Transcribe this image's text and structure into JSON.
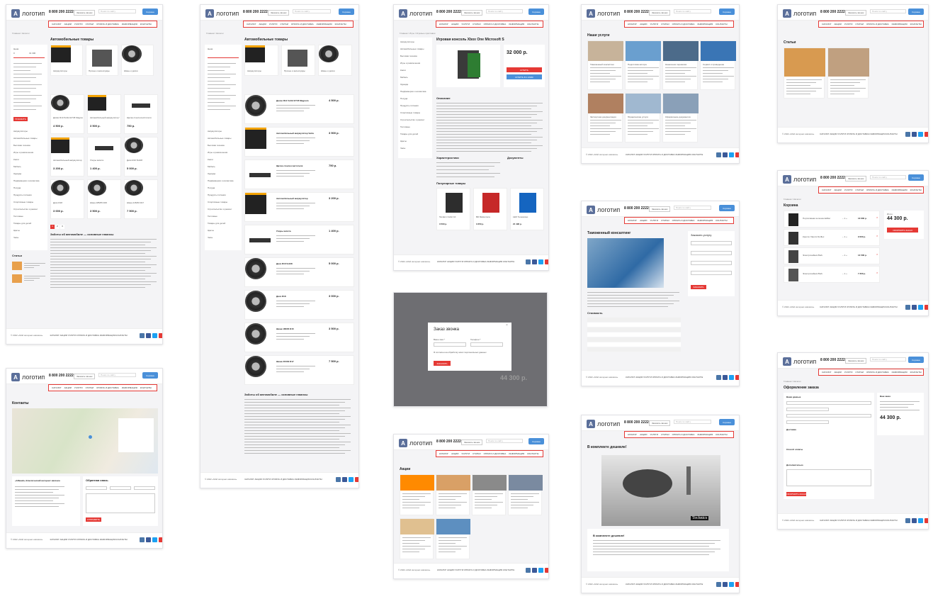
{
  "header": {
    "logo_text": "логотип",
    "phone": "8 800 200 2222",
    "callback": "Заказать звонок",
    "search_placeholder": "Поиск по сайту",
    "cart": "Корзина"
  },
  "nav": [
    "КАТАЛОГ",
    "АКЦИИ",
    "УСЛУГИ",
    "СТАТЬИ",
    "ОПЛАТА И ДОСТАВКА",
    "ИНФОРМАЦИЯ",
    "КОНТАКТЫ"
  ],
  "footer": {
    "copyright": "© 2022 «Мой интернет-магазин»",
    "links": "КАТАЛОГ  АКЦИИ  УСЛУГИ  ОПЛАТА И ДОСТАВКА  ИНФОРМАЦИЯ  КОНТАКТЫ"
  },
  "colors": {
    "accent": "#e53935",
    "brand": "#5b6f9a",
    "blue": "#4a90d9"
  },
  "pages": {
    "catalog": {
      "crumb": "Главная / Каталог",
      "title": "Автомобильные товары",
      "categories": [
        "Аккумуляторы",
        "Прочее и аксессуары",
        "Шины и диски"
      ],
      "filter_price": "Цена",
      "filter_from": "0",
      "filter_to": "31 300",
      "show_button": "ПОКАЗАТЬ",
      "sidebar": [
        "Аккумуляторы",
        "Автомобильные товары",
        "Бытовая техника",
        "Игры и развлечения",
        "Книги",
        "Мебель",
        "Одежда",
        "Парфюмерия и косметика",
        "Посуда",
        "Продукты питания",
        "Спортивные товары",
        "Строительство и ремонт",
        "Тепловые",
        "Товары для детей",
        "Цветы",
        "Часы"
      ],
      "products": [
        {
          "name": "Диски R14 5x112 ET45 Magnum",
          "price": "4 500 р."
        },
        {
          "name": "Автомобильный аккумулятор Varta",
          "price": "3 500 р."
        },
        {
          "name": "Щетка стеклоочистителя",
          "price": "750 р."
        },
        {
          "name": "Автомобильный аккумулятор",
          "price": "3 200 р."
        },
        {
          "name": "Упоры капота",
          "price": "1 400 р."
        },
        {
          "name": "Диск R16 5x108",
          "price": "5 000 р."
        },
        {
          "name": "Диск R18",
          "price": "3 000 р."
        },
        {
          "name": "Шина 185/65 R15",
          "price": "3 500 р."
        },
        {
          "name": "Шина 215/60 R17",
          "price": "7 500 р."
        }
      ],
      "seo_title": "Заботы об автомобиле — основные нюансы",
      "articles_title": "Статьи",
      "pager": [
        "1",
        "2",
        "3"
      ]
    },
    "product": {
      "crumb": "Главная / Игры / Игровые приставки",
      "title": "Игровая консоль Xbox One Microsoft S",
      "price": "32 000 р.",
      "buy": "КУПИТЬ",
      "oneclick": "КУПИТЬ В 1 КЛИК",
      "desc_title": "Описание",
      "chars_title": "Характеристики",
      "docs_title": "Документы",
      "popular_title": "Популярные товары",
      "popular": [
        {
          "name": "Tandem Cubic 10",
          "price": "3 500 р."
        },
        {
          "name": "Bill Matsumura",
          "price": "3 250 р."
        },
        {
          "name": "LED Телевизор",
          "price": "21 490 р."
        }
      ]
    },
    "modal": {
      "title": "Заказ звонка",
      "name_label": "Ваше имя *",
      "phone_label": "Телефон *",
      "agree": "Я согласен на обработку моих персональных данных",
      "submit": "ЗАКАЗАТЬ",
      "bg_price": "44 300 р."
    },
    "services": {
      "title": "Наши услуги",
      "items": [
        "Таможенный консалтинг",
        "Подготовка мотора",
        "Нанесение перевозки",
        "Сервис и проведение",
        "Экспортная документация",
        "Юридические услуги",
        "Оформление документов"
      ]
    },
    "customs": {
      "title": "Таможенный консалтинг",
      "form_title": "Заказать услугу",
      "costs_title": "Стоимость",
      "submit": "ЗАКАЗАТЬ"
    },
    "news": {
      "title": "В комплекте дешевле!",
      "brand": "Technics",
      "subtitle": "В комплекте дешевле!"
    },
    "articles": {
      "title": "Статьи"
    },
    "cart": {
      "title": "Корзина",
      "items": [
        {
          "name": "Портативная колонка Edifier",
          "price": "13 600 р."
        },
        {
          "name": "Кресло Xiaomi Dorflex",
          "price": "9 000 р."
        },
        {
          "name": "Электрочайник Bork",
          "price": "14 500 р."
        },
        {
          "name": "Электрочайник Bork",
          "price": "7 200 р."
        }
      ],
      "total_label": "Итого",
      "total": "44 300 р.",
      "checkout": "ОФОРМИТЬ ЗАКАЗ"
    },
    "checkout": {
      "title": "Оформление заказа",
      "your_data": "Ваши данные",
      "delivery": "Доставка",
      "payment": "Способ оплаты",
      "extra": "Дополнительно",
      "your_order": "Ваш заказ",
      "total": "44 300 р.",
      "submit": "ОФОРМИТЬ ЗАКАЗ"
    },
    "contacts": {
      "title": "Контакты",
      "shop_name": "«Alfaweb» Классический интернет магазин",
      "feedback_title": "Обратная связь",
      "submit": "ОТПРАВИТЬ"
    },
    "promos": {
      "title": "Акции"
    }
  }
}
